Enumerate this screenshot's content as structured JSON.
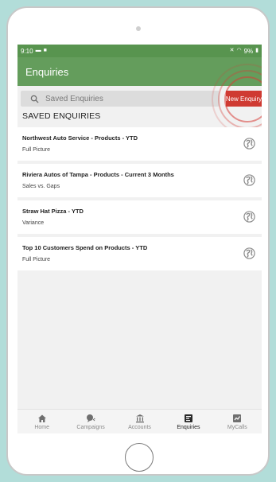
{
  "status_bar": {
    "time": "9:10",
    "battery": "9%"
  },
  "app_bar": {
    "title": "Enquiries"
  },
  "search": {
    "placeholder": "Saved Enquiries"
  },
  "new_enquiry_label": "New Enquiry",
  "section_title": "SAVED ENQUIRIES",
  "enquiries": [
    {
      "title": "Northwest Auto Service - Products - YTD",
      "subtitle": "Full Picture"
    },
    {
      "title": "Riviera Autos of Tampa - Products - Current 3 Months",
      "subtitle": "Sales vs. Gaps"
    },
    {
      "title": "Straw Hat Pizza - YTD",
      "subtitle": "Variance"
    },
    {
      "title": "Top 10 Customers Spend on Products - YTD",
      "subtitle": "Full Picture"
    }
  ],
  "tabs": [
    {
      "label": "Home",
      "icon": "home-icon"
    },
    {
      "label": "Campaigns",
      "icon": "campaigns-icon"
    },
    {
      "label": "Accounts",
      "icon": "bank-icon"
    },
    {
      "label": "Enquiries",
      "icon": "enquiries-icon",
      "active": true
    },
    {
      "label": "MyCalls",
      "icon": "calls-icon"
    }
  ],
  "colors": {
    "app_bar": "#649d5c",
    "status_bar": "#58944f",
    "accent": "#cf3a32",
    "background": "#b2ddd9"
  }
}
